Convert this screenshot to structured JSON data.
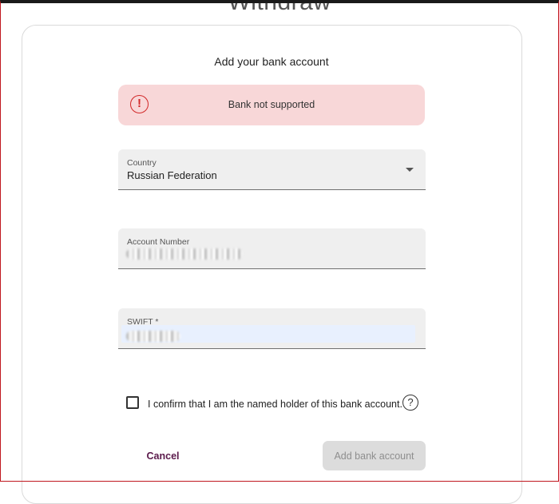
{
  "page": {
    "title": "Withdraw"
  },
  "card": {
    "title": "Add your bank account"
  },
  "alert": {
    "icon": "exclamation-circle-icon",
    "icon_glyph": "!",
    "message": "Bank not supported"
  },
  "country": {
    "label": "Country",
    "value": "Russian Federation"
  },
  "account_number": {
    "label": "Account Number"
  },
  "swift": {
    "label": "SWIFT *"
  },
  "confirm": {
    "label": "I confirm that I am the named holder of this bank account.",
    "checked": false,
    "help_glyph": "?"
  },
  "actions": {
    "cancel_label": "Cancel",
    "add_label": "Add bank account"
  },
  "colors": {
    "alert_bg": "#f8d7d8",
    "alert_icon": "#d22a2a",
    "cancel_text": "#5b1a4b",
    "disabled_button_bg": "#dcdcdc"
  }
}
